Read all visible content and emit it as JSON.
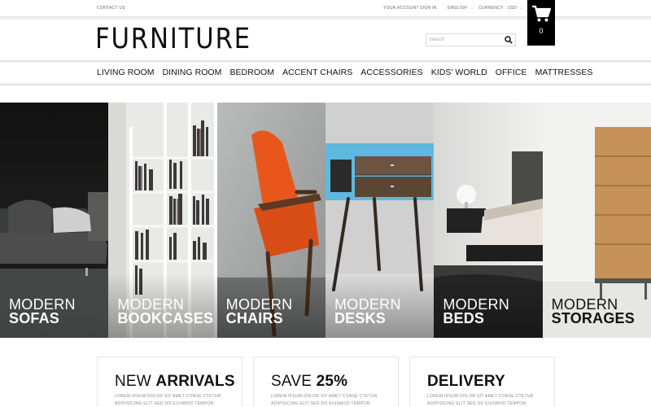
{
  "topbar": {
    "contact": "CONTACT US",
    "your_account": "YOUR ACCOUNT",
    "sign_in": "SIGN IN",
    "language": "ENGLISH",
    "currency": "CURRENCY : USD"
  },
  "cart": {
    "count": "0",
    "icon": "shopping-cart-icon"
  },
  "logo": "FURNITURE",
  "search": {
    "placeholder": "Search",
    "icon": "search-icon"
  },
  "nav": {
    "items": [
      "LIVING ROOM",
      "DINING ROOM",
      "BEDROOM",
      "ACCENT CHAIRS",
      "ACCESSORIES",
      "KIDS' WORLD",
      "OFFICE",
      "MATTRESSES"
    ]
  },
  "banners": [
    {
      "line1": "MODERN",
      "line2": "SOFAS"
    },
    {
      "line1": "MODERN",
      "line2": "BOOKCASES"
    },
    {
      "line1": "MODERN",
      "line2": "CHAIRS"
    },
    {
      "line1": "MODERN",
      "line2": "DESKS"
    },
    {
      "line1": "MODERN",
      "line2": "BEDS"
    },
    {
      "line1": "MODERN",
      "line2": "STORAGES"
    }
  ],
  "promos": [
    {
      "thin": "NEW ",
      "bold": "ARRIVALS",
      "desc": "LOREM IPSUM DOLOR SIT AMET CONSE CTETUR ADIPISICING ELIT SED DO EIUSMOD TEMPOR."
    },
    {
      "thin": "SAVE ",
      "bold": "25%",
      "desc": "LOREM IPSUM DOLOR SIT AMET CONSE CTETUR ADIPISICING ELIT SED DO EIUSMOD TEMPOR."
    },
    {
      "thin": "",
      "bold": "DELIVERY",
      "desc": "LOREM IPSUM DOLOR SIT AMET CONSE CTETUR ADIPISICING ELIT SED DO EIUSMOD TEMPOR."
    }
  ],
  "colors": {
    "accent": "#000000",
    "chair_orange": "#e8561c",
    "desk_blue": "#5fb8e0"
  }
}
